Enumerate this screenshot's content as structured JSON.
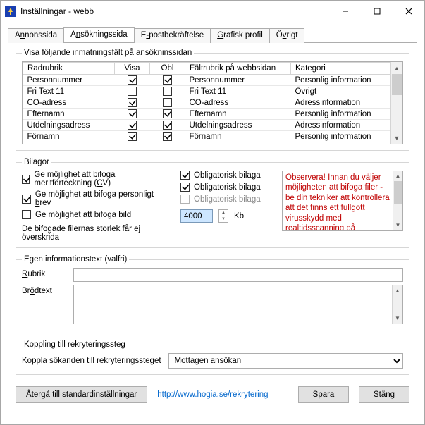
{
  "window": {
    "title": "Inställningar - webb"
  },
  "tabs": {
    "items": [
      {
        "label_pre": "A",
        "label_u": "n",
        "label_post": "nonssida"
      },
      {
        "label_pre": "A",
        "label_u": "n",
        "label_post": "sökningssida"
      },
      {
        "label_pre": "E",
        "label_u": "-",
        "label_post": "postbekräftelse"
      },
      {
        "label_pre": "",
        "label_u": "G",
        "label_post": "rafisk profil"
      },
      {
        "label_pre": "Ö",
        "label_u": "v",
        "label_post": "rigt"
      }
    ]
  },
  "fields_section": {
    "legend_pre": "",
    "legend_u": "V",
    "legend_post": "isa följande inmatningsfält på ansökninssidan",
    "columns": {
      "c1": "Radrubrik",
      "c2": "Visa",
      "c3": "Obl",
      "c4": "Fältrubrik på webbsidan",
      "c5": "Kategori"
    },
    "rows": [
      {
        "radrubrik": "Personnummer",
        "visa": true,
        "obl": true,
        "falt": "Personnummer",
        "kategori": "Personlig information"
      },
      {
        "radrubrik": "Fri Text 11",
        "visa": false,
        "obl": false,
        "falt": "Fri Text 11",
        "kategori": "Övrigt"
      },
      {
        "radrubrik": "CO-adress",
        "visa": true,
        "obl": false,
        "falt": "CO-adress",
        "kategori": "Adressinformation"
      },
      {
        "radrubrik": "Efternamn",
        "visa": true,
        "obl": true,
        "falt": "Efternamn",
        "kategori": "Personlig information"
      },
      {
        "radrubrik": "Utdelningsadress",
        "visa": true,
        "obl": true,
        "falt": "Utdelningsadress",
        "kategori": "Adressinformation"
      },
      {
        "radrubrik": "Förnamn",
        "visa": true,
        "obl": true,
        "falt": "Förnamn",
        "kategori": "Personlig information"
      }
    ]
  },
  "bilagor": {
    "legend": "Bilagor",
    "cv_pre": "",
    "cv": "Ge möjlighet att bifoga meritförteckning (",
    "cv_u": "C",
    "cv_post": "V)",
    "cv_checked": true,
    "brev_pre": "Ge möjlighet att bifoga personligt ",
    "brev_u": "b",
    "brev_post": "rev",
    "brev_checked": true,
    "bild_pre": "Ge möjlighet att bifoga b",
    "bild_u": "i",
    "bild_post": "ld",
    "bild_checked": false,
    "obl1": "Obligatorisk bilaga",
    "obl1c": true,
    "obl2": "Obligatorisk bilaga",
    "obl2c": true,
    "obl3": "Obligatorisk bilaga",
    "obl3c": false,
    "size_label": "De bifogade filernas storlek får ej överskrida",
    "size_value": "4000",
    "size_unit": "Kb",
    "warning": "Observera! Innan du väljer möjligheten att bifoga filer - be din tekniker att kontrollera att det finns ett fullgott virusskydd med realtidsscanning på webbservern! Filerna lagras"
  },
  "info": {
    "legend": "Egen informationstext (valfri)",
    "rubrik_pre": "",
    "rubrik_u": "R",
    "rubrik_post": "ubrik",
    "brod_pre": "Br",
    "brod_u": "ö",
    "brod_post": "dtext",
    "rubrik_value": "",
    "brod_value": ""
  },
  "koppling": {
    "legend": "Koppling till rekryteringssteg",
    "label_pre": "",
    "label_u": "K",
    "label_post": "oppla sökanden till rekryteringssteget",
    "selected": "Mottagen ansökan"
  },
  "bottom": {
    "reset_pre": "Å",
    "reset_u": "t",
    "reset_post": "ergå till standardinställningar",
    "link": "http://www.hogia.se/rekrytering",
    "save_pre": "",
    "save_u": "S",
    "save_post": "para",
    "close_pre": "S",
    "close_u": "t",
    "close_post": "äng"
  }
}
